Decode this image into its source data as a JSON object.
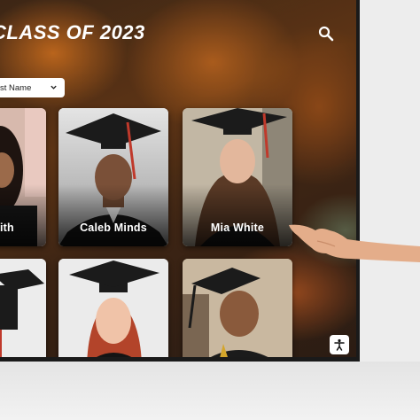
{
  "header": {
    "title": "CLASS OF 2023",
    "search_icon": "search-icon"
  },
  "sort": {
    "selected": "st Name",
    "icon": "chevron-down-icon"
  },
  "graduates": [
    {
      "name": "ith"
    },
    {
      "name": "Caleb Minds"
    },
    {
      "name": "Mia White"
    },
    {
      "name": ""
    },
    {
      "name": ""
    },
    {
      "name": ""
    }
  ],
  "accessibility": {
    "icon": "accessibility-icon"
  },
  "colors": {
    "title_text": "#ffffff",
    "card_name_text": "#ffffff",
    "cap": "#1b1b1b",
    "tassel": "#c0392b"
  }
}
